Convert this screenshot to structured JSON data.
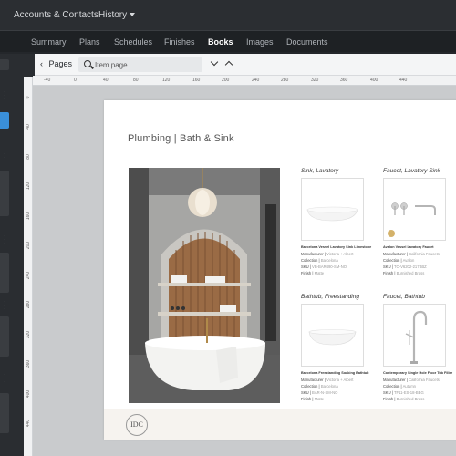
{
  "topbar": {
    "breadcrumb": "Accounts & Contacts",
    "history_label": "History"
  },
  "tabs": [
    {
      "label": "Summary"
    },
    {
      "label": "Plans"
    },
    {
      "label": "Schedules"
    },
    {
      "label": "Finishes"
    },
    {
      "label": "Books"
    },
    {
      "label": "Images"
    },
    {
      "label": "Documents"
    }
  ],
  "toolbar": {
    "pages_label": "Pages",
    "search_placeholder": "Item page"
  },
  "ruler": {
    "h_ticks": [
      "-40",
      "0",
      "40",
      "80",
      "120",
      "160",
      "200",
      "240",
      "280",
      "320",
      "360",
      "400",
      "440"
    ],
    "v_ticks": [
      "0",
      "40",
      "80",
      "120",
      "160",
      "200",
      "240",
      "280",
      "320",
      "360",
      "400",
      "440"
    ]
  },
  "page": {
    "title": "Plumbing | Bath & Sink",
    "logo_text": "IDC",
    "cards": [
      {
        "title": "Sink, Lavatory",
        "product": "Barcelona Vessel Lavatory Sink Limestone",
        "manufacturer_label": "Manufacturer",
        "manufacturer": "Victoria + Albert",
        "collection_label": "Collection",
        "collection": "Barcelona",
        "sku_label": "SKU",
        "sku": "VB-BAR490-SM-NO",
        "finish_label": "Finish",
        "finish": "Matte"
      },
      {
        "title": "Faucet, Lavatory Sink",
        "product": "Avalon Vessel Lavatory Faucet",
        "manufacturer_label": "Manufacturer",
        "manufacturer": "California Faucets",
        "collection_label": "Collection",
        "collection": "Avalon",
        "sku_label": "SKU",
        "sku": "TO-V6202-217BBZ",
        "finish_label": "Finish",
        "finish": "Burnished Brass"
      },
      {
        "title": "Bathtub, Freestanding",
        "product": "Barcelona Freestanding Soaking Bathtub",
        "manufacturer_label": "Manufacturer",
        "manufacturer": "Victoria + Albert",
        "collection_label": "Collection",
        "collection": "Barcelona",
        "sku_label": "SKU",
        "sku": "BAR-N-SM-NO",
        "finish_label": "Finish",
        "finish": "Matte"
      },
      {
        "title": "Faucet, Bathtub",
        "product": "Contemporary Single Hole Floor Tub Filler",
        "manufacturer_label": "Manufacturer",
        "manufacturer": "California Faucets",
        "collection_label": "Collection",
        "collection": "Autumn",
        "sku_label": "SKU",
        "sku": "TF11-ES-18-BBG",
        "finish_label": "Finish",
        "finish": "Burnished Brass"
      }
    ]
  }
}
